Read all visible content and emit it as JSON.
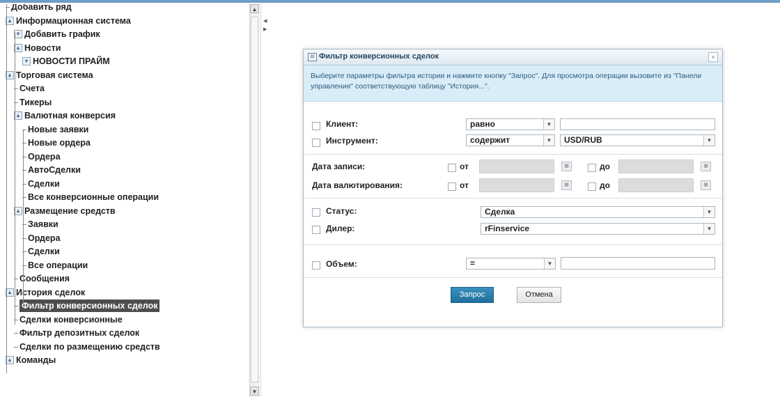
{
  "tree": {
    "items": [
      {
        "label": "Добавить ряд",
        "toggle": ""
      },
      {
        "label": "Информационная система",
        "toggle": "-"
      },
      {
        "label": "Добавить график",
        "toggle": "+"
      },
      {
        "label": "Новости",
        "toggle": "-"
      },
      {
        "label": "НОВОСТИ ПРАЙМ",
        "toggle": "+"
      },
      {
        "label": "Торговая система",
        "toggle": "-"
      },
      {
        "label": "Счета",
        "toggle": ""
      },
      {
        "label": "Тикеры",
        "toggle": ""
      },
      {
        "label": "Валютная конверсия",
        "toggle": "-"
      },
      {
        "label": "Новые заявки",
        "toggle": ""
      },
      {
        "label": "Новые ордера",
        "toggle": ""
      },
      {
        "label": "Ордера",
        "toggle": ""
      },
      {
        "label": "АвтоСделки",
        "toggle": ""
      },
      {
        "label": "Сделки",
        "toggle": ""
      },
      {
        "label": "Все конверсионные операции",
        "toggle": ""
      },
      {
        "label": "Размещение средств",
        "toggle": "-"
      },
      {
        "label": "Заявки",
        "toggle": ""
      },
      {
        "label": "Ордера",
        "toggle": ""
      },
      {
        "label": "Сделки",
        "toggle": ""
      },
      {
        "label": "Все операции",
        "toggle": ""
      },
      {
        "label": "Сообщения",
        "toggle": ""
      },
      {
        "label": "История сделок",
        "toggle": "-"
      },
      {
        "label": "Фильтр конверсионных сделок",
        "toggle": "",
        "selected": true
      },
      {
        "label": "Сделки конверсионные",
        "toggle": ""
      },
      {
        "label": "Фильтр депозитных сделок",
        "toggle": ""
      },
      {
        "label": "Сделки по размещению средств",
        "toggle": ""
      },
      {
        "label": "Команды",
        "toggle": "-"
      }
    ]
  },
  "dialog": {
    "title": "Фильтр конверсионных сделок",
    "close": "×",
    "info": "Выберите параметры фильтра истории и нажмите кнопку \"Запрос\". Для просмотра операции вызовите из \"Панели управления\" соответствующую таблицу \"История...\".",
    "client": {
      "label": "Клиент:",
      "operator": "равно",
      "value": ""
    },
    "instrument": {
      "label": "Инструмент:",
      "operator": "содержит",
      "value": "USD/RUB"
    },
    "record_date": {
      "label": "Дата записи:",
      "from": "от",
      "to": "до"
    },
    "value_date": {
      "label": "Дата валютирования:",
      "from": "от",
      "to": "до"
    },
    "status": {
      "label": "Статус:",
      "value": "Сделка"
    },
    "dealer": {
      "label": "Дилер:",
      "value": "rFinservice"
    },
    "volume": {
      "label": "Объем:",
      "operator": "=",
      "value": ""
    },
    "submit": "Запрос",
    "cancel": "Отмена"
  }
}
